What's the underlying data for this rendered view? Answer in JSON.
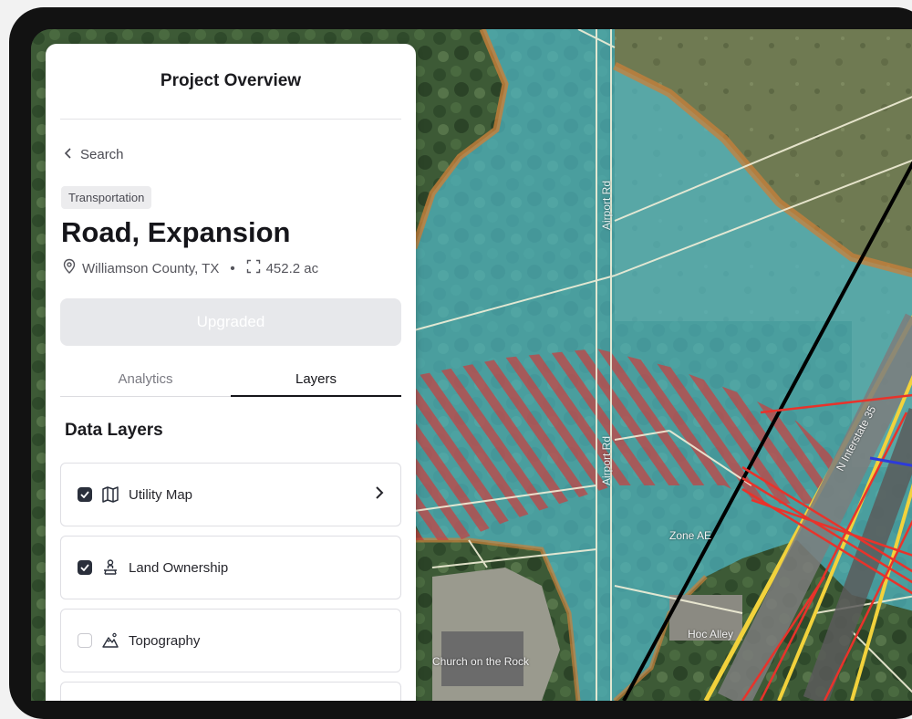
{
  "panel": {
    "title": "Project Overview",
    "back_label": "Search",
    "category": "Transportation",
    "project_name": "Road, Expansion",
    "location": "Williamson County, TX",
    "area": "452.2 ac",
    "upgrade_label": "Upgraded",
    "tabs": [
      {
        "label": "Analytics",
        "active": false
      },
      {
        "label": "Layers",
        "active": true
      }
    ],
    "section_title": "Data Layers",
    "layers": [
      {
        "label": "Utility Map",
        "checked": true,
        "icon": "map-icon",
        "has_chevron": true
      },
      {
        "label": "Land Ownership",
        "checked": true,
        "icon": "person-pin-icon",
        "has_chevron": false
      },
      {
        "label": "Topography",
        "checked": false,
        "icon": "mountain-icon",
        "has_chevron": false
      }
    ]
  },
  "map": {
    "labels": {
      "airport_rd": "Airport Rd",
      "interstate": "N Interstate 35",
      "zone": "Zone AE",
      "church": "Church on the Rock",
      "hoc_alley": "Hoc Alley"
    }
  },
  "colors": {
    "flood_zone": "#4fb8c6",
    "flood_border": "#c9803a",
    "hatch": "#c84040",
    "utility_red": "#e8332b",
    "highway_yellow": "#f2d23c",
    "panel_bg": "#ffffff"
  }
}
